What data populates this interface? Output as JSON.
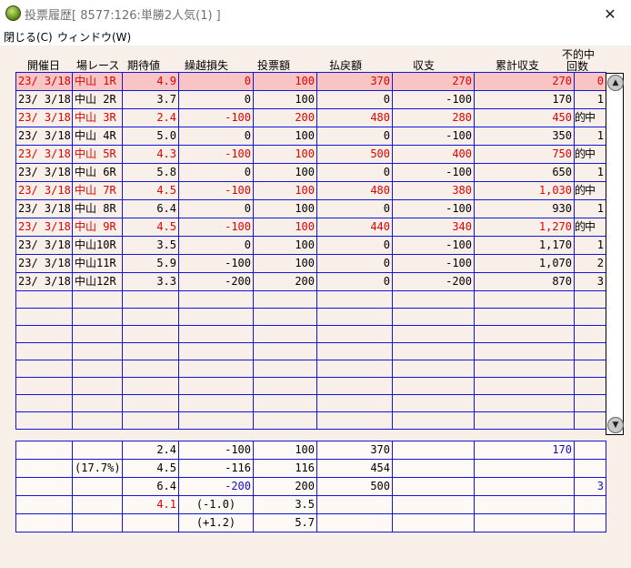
{
  "window": {
    "title": "投票履歴[ 8577:126:単勝2人気(1) ]",
    "close_glyph": "✕"
  },
  "menu": [
    "閉じる(C)",
    "ウィンドウ(W)"
  ],
  "columns": [
    "開催日",
    "場レース",
    "期待値",
    "繰越損失",
    "投票額",
    "払戻額",
    "収支",
    "累計収支",
    "不的中",
    "回数"
  ],
  "rows": [
    {
      "date": "23/ 3/18",
      "race": "中山 1R",
      "ev": "4.9",
      "carry": "0",
      "bet": "100",
      "payout": "370",
      "balance": "270",
      "cumulative": "270",
      "miss": "0",
      "style": "highlight"
    },
    {
      "date": "23/ 3/18",
      "race": "中山 2R",
      "ev": "3.7",
      "carry": "0",
      "bet": "100",
      "payout": "0",
      "balance": "-100",
      "cumulative": "170",
      "miss": "1",
      "style": "black"
    },
    {
      "date": "23/ 3/18",
      "race": "中山 3R",
      "ev": "2.4",
      "carry": "-100",
      "bet": "200",
      "payout": "480",
      "balance": "280",
      "cumulative": "450",
      "miss": "的中",
      "style": "red"
    },
    {
      "date": "23/ 3/18",
      "race": "中山 4R",
      "ev": "5.0",
      "carry": "0",
      "bet": "100",
      "payout": "0",
      "balance": "-100",
      "cumulative": "350",
      "miss": "1",
      "style": "black"
    },
    {
      "date": "23/ 3/18",
      "race": "中山 5R",
      "ev": "4.3",
      "carry": "-100",
      "bet": "100",
      "payout": "500",
      "balance": "400",
      "cumulative": "750",
      "miss": "的中",
      "style": "red"
    },
    {
      "date": "23/ 3/18",
      "race": "中山 6R",
      "ev": "5.8",
      "carry": "0",
      "bet": "100",
      "payout": "0",
      "balance": "-100",
      "cumulative": "650",
      "miss": "1",
      "style": "black"
    },
    {
      "date": "23/ 3/18",
      "race": "中山 7R",
      "ev": "4.5",
      "carry": "-100",
      "bet": "100",
      "payout": "480",
      "balance": "380",
      "cumulative": "1,030",
      "miss": "的中",
      "style": "red"
    },
    {
      "date": "23/ 3/18",
      "race": "中山 8R",
      "ev": "6.4",
      "carry": "0",
      "bet": "100",
      "payout": "0",
      "balance": "-100",
      "cumulative": "930",
      "miss": "1",
      "style": "black"
    },
    {
      "date": "23/ 3/18",
      "race": "中山 9R",
      "ev": "4.5",
      "carry": "-100",
      "bet": "100",
      "payout": "440",
      "balance": "340",
      "cumulative": "1,270",
      "miss": "的中",
      "style": "red"
    },
    {
      "date": "23/ 3/18",
      "race": "中山10R",
      "ev": "3.5",
      "carry": "0",
      "bet": "100",
      "payout": "0",
      "balance": "-100",
      "cumulative": "1,170",
      "miss": "1",
      "style": "black"
    },
    {
      "date": "23/ 3/18",
      "race": "中山11R",
      "ev": "5.9",
      "carry": "-100",
      "bet": "100",
      "payout": "0",
      "balance": "-100",
      "cumulative": "1,070",
      "miss": "2",
      "style": "black"
    },
    {
      "date": "23/ 3/18",
      "race": "中山12R",
      "ev": "3.3",
      "carry": "-200",
      "bet": "200",
      "payout": "0",
      "balance": "-200",
      "cumulative": "870",
      "miss": "3",
      "style": "black"
    }
  ],
  "summary": [
    [
      "",
      "",
      "2.4",
      "-100",
      "100",
      "370",
      "",
      "170",
      ""
    ],
    [
      "",
      "(17.7%)",
      "4.5",
      "-116",
      "116",
      "454",
      "",
      "",
      ""
    ],
    [
      "",
      "",
      "6.4",
      "-200",
      "200",
      "500",
      "",
      "",
      "3"
    ],
    [
      "",
      "",
      "4.1",
      "(-1.0)",
      "3.5",
      "",
      "",
      "",
      ""
    ],
    [
      "",
      "",
      "",
      "(+1.2)",
      "5.7",
      "",
      "",
      "",
      ""
    ]
  ],
  "scroll_icons": {
    "up": "▲",
    "down": "▼"
  }
}
